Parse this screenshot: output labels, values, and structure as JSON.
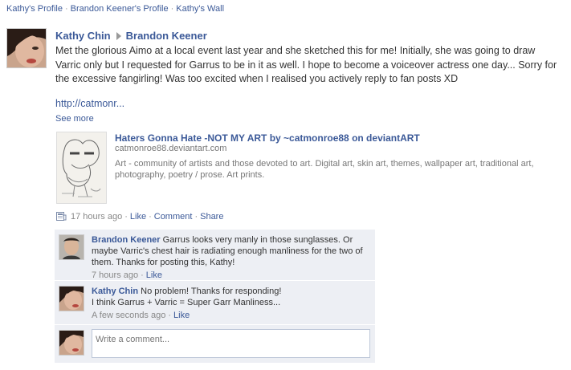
{
  "breadcrumb": {
    "items": [
      "Kathy's Profile",
      "Brandon Keener's Profile",
      "Kathy's Wall"
    ],
    "separator": "·"
  },
  "post": {
    "author": "Kathy Chin",
    "target": "Brandon Keener",
    "text": "Met the glorious Aimo at a local event last year and she sketched this for me! Initially, she was going to draw Varric only but I requested for Garrus to be in it as well. I hope to become a voiceover actress one day... Sorry for the excessive fangirling! Was too excited when I realised you actively reply to fan posts XD",
    "link_text": "http://catmonr...",
    "see_more": "See more",
    "attachment": {
      "title": "Haters Gonna Hate -NOT MY ART by ~catmonroe88 on deviantART",
      "domain": "catmonroe88.deviantart.com",
      "description": "Art - community of artists and those devoted to art. Digital art, skin art, themes, wallpaper art, traditional art, photography, poetry / prose. Art prints."
    },
    "meta": {
      "time": "17 hours ago",
      "like": "Like",
      "comment": "Comment",
      "share": "Share",
      "separator": "·"
    }
  },
  "comments": [
    {
      "author": "Brandon Keener",
      "text": "Garrus looks very manly in those sunglasses. Or maybe Varric's chest hair is radiating enough manliness for the two of them. Thanks for posting this, Kathy!",
      "time": "7 hours ago",
      "like": "Like"
    },
    {
      "author": "Kathy Chin",
      "text_line1": "No problem! Thanks for responding!",
      "text_line2": "I think Garrus + Varric = Super Garr Manliness...",
      "time": "A few seconds ago",
      "like": "Like"
    }
  ],
  "write_comment": {
    "placeholder": "Write a comment..."
  },
  "colors": {
    "link": "#3b5998",
    "comment_bg": "#edeff4",
    "muted": "#888888"
  }
}
